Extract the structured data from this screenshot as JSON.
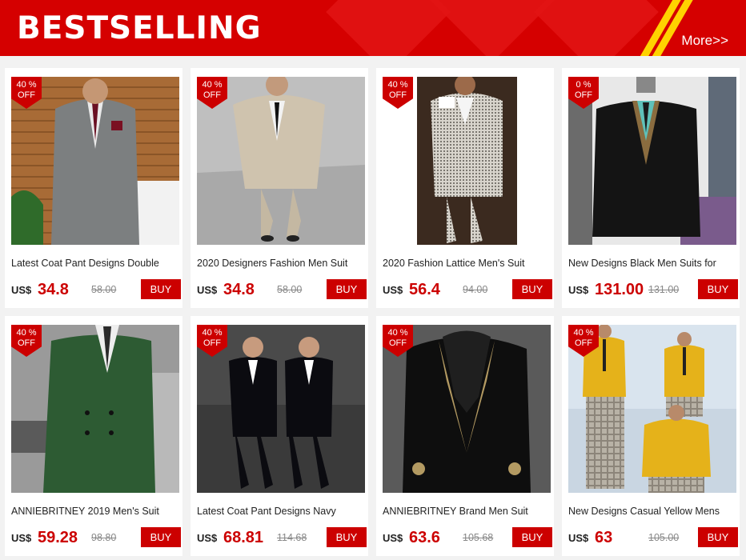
{
  "banner": {
    "title": "BESTSELLING",
    "more": "More>>"
  },
  "products": [
    {
      "title": "Latest Coat Pant Designs Double",
      "currency": "US$",
      "price": "34.8",
      "old_price": "58.00",
      "badge_pct": "40 %",
      "badge_off": "OFF",
      "buy": "BUY"
    },
    {
      "title": "2020 Designers Fashion Men Suit",
      "currency": "US$",
      "price": "34.8",
      "old_price": "58.00",
      "badge_pct": "40 %",
      "badge_off": "OFF",
      "buy": "BUY"
    },
    {
      "title": "2020 Fashion Lattice Men's Suit",
      "currency": "US$",
      "price": "56.4",
      "old_price": "94.00",
      "badge_pct": "40 %",
      "badge_off": "OFF",
      "buy": "BUY"
    },
    {
      "title": "New Designs Black Men Suits for",
      "currency": "US$",
      "price": "131.00",
      "old_price": "131.00",
      "badge_pct": "0 %",
      "badge_off": "OFF",
      "buy": "BUY"
    },
    {
      "title": "ANNIEBRITNEY 2019 Men's Suit",
      "currency": "US$",
      "price": "59.28",
      "old_price": "98.80",
      "badge_pct": "40 %",
      "badge_off": "OFF",
      "buy": "BUY"
    },
    {
      "title": "Latest Coat Pant Designs Navy",
      "currency": "US$",
      "price": "68.81",
      "old_price": "114.68",
      "badge_pct": "40 %",
      "badge_off": "OFF",
      "buy": "BUY"
    },
    {
      "title": "ANNIEBRITNEY Brand Men Suit",
      "currency": "US$",
      "price": "63.6",
      "old_price": "105.68",
      "badge_pct": "40 %",
      "badge_off": "OFF",
      "buy": "BUY"
    },
    {
      "title": "New Designs Casual Yellow Mens",
      "currency": "US$",
      "price": "63",
      "old_price": "105.00",
      "badge_pct": "40 %",
      "badge_off": "OFF",
      "buy": "BUY"
    }
  ]
}
